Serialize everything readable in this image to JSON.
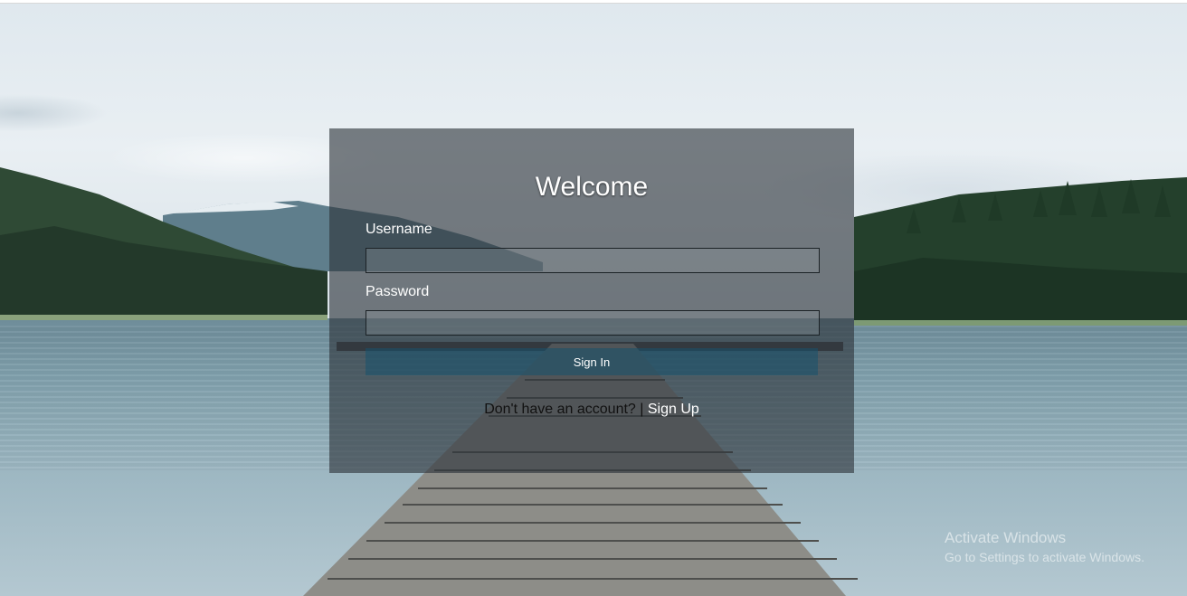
{
  "login": {
    "title": "Welcome",
    "username_label": "Username",
    "username_value": "",
    "password_label": "Password",
    "password_value": "",
    "signin_label": "Sign In",
    "signup_prompt": "Don't have an account?",
    "separator": "|",
    "signup_label": "Sign Up"
  },
  "watermark": {
    "title": "Activate Windows",
    "subtitle": "Go to Settings to activate Windows."
  },
  "colors": {
    "card_overlay": "#2d343a",
    "button": "#16526e",
    "text": "#ffffff"
  }
}
